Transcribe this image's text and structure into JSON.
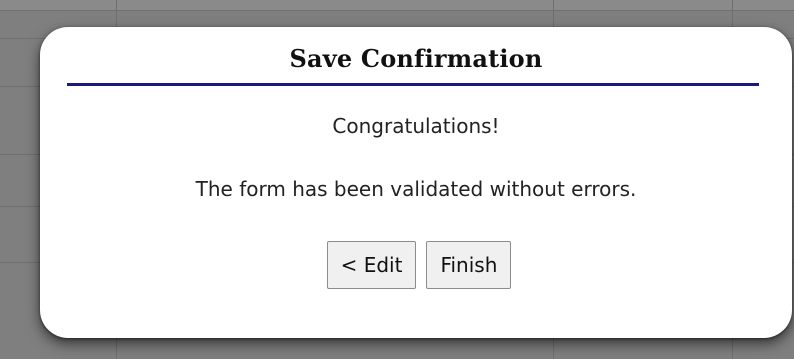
{
  "dialog": {
    "title": "Save Confirmation",
    "congrats": "Congratulations!",
    "message": "The form has been validated without errors.",
    "buttons": {
      "edit_label": "< Edit",
      "finish_label": "Finish"
    }
  },
  "colors": {
    "overlay": "#7f7f7f",
    "dialog_bg": "#ffffff",
    "title_rule": "#1a1a7a",
    "button_bg": "#f0f0f0"
  }
}
